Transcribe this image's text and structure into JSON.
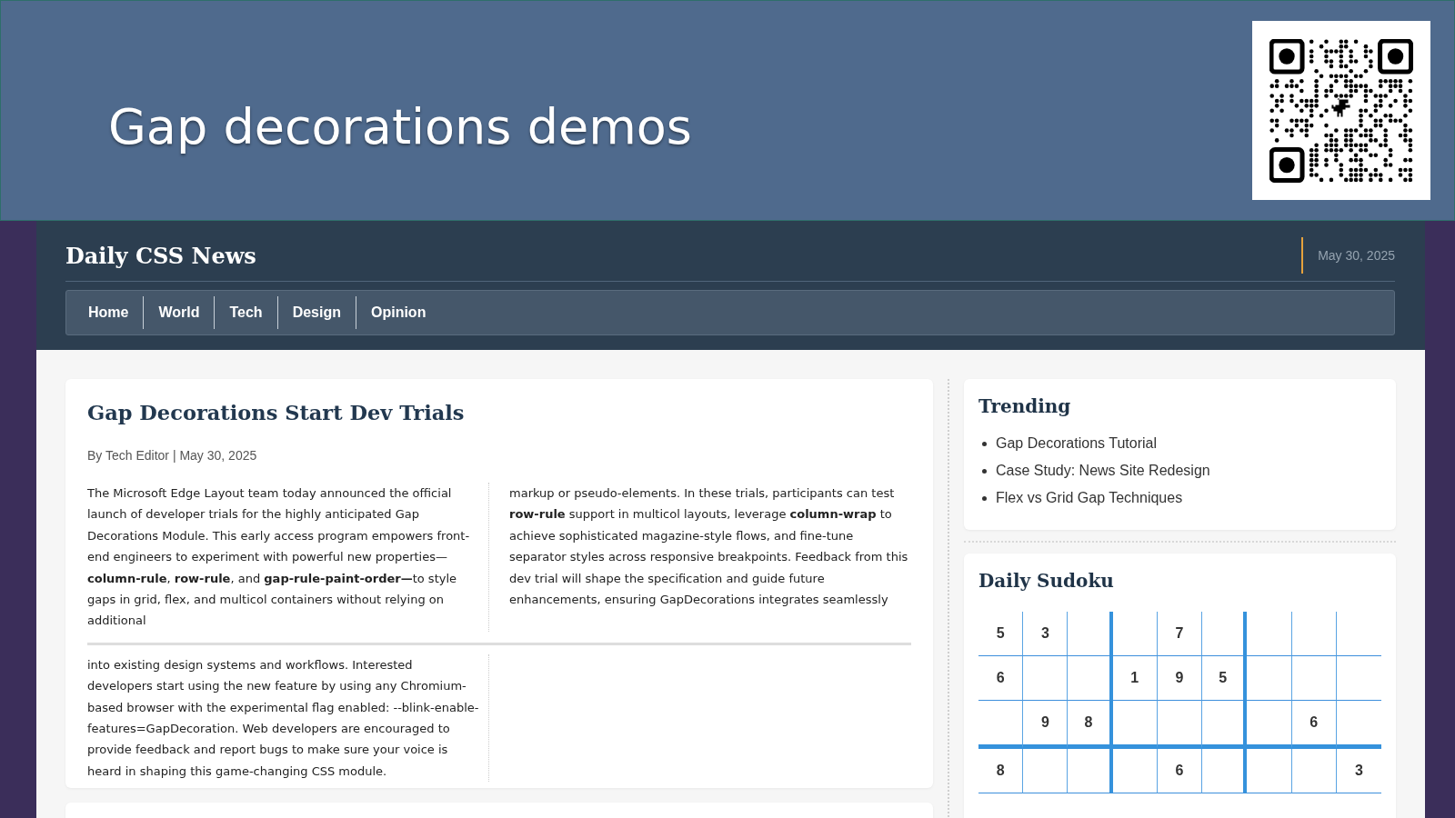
{
  "slide": {
    "title": "Gap decorations demos"
  },
  "site": {
    "title": "Daily CSS News",
    "date": "May 30, 2025",
    "nav": [
      {
        "label": "Home"
      },
      {
        "label": "World"
      },
      {
        "label": "Tech"
      },
      {
        "label": "Design"
      },
      {
        "label": "Opinion"
      }
    ]
  },
  "article": {
    "headline": "Gap Decorations Start Dev Trials",
    "byline": "By Tech Editor | May 30, 2025",
    "columns": [
      "The Microsoft Edge Layout team today announced the official launch of developer trials for the highly anticipated Gap Decorations Module. This early access program empowers front-end engineers to experiment with powerful new properties—**column-rule**, **row-rule**, and **gap-rule-paint-order—**to style gaps in grid, flex, and multicol containers without relying on additional",
      "markup or pseudo-elements. In these trials, participants can test **row-rule** support in multicol layouts, leverage **column-wrap** to achieve sophisticated magazine-style flows, and fine-tune separator styles across responsive breakpoints. Feedback from this dev trial will shape the specification and guide future enhancements, ensuring GapDecorations integrates seamlessly",
      "into existing design systems and workflows. Interested developers start using the new feature by using any Chromium-based browser with the experimental flag enabled: --blink-enable-features=GapDecoration. Web developers are encouraged to provide feedback and report bugs to make sure your voice is heard in shaping this game-changing CSS module."
    ]
  },
  "trending": {
    "title": "Trending",
    "items": [
      "Gap Decorations Tutorial",
      "Case Study: News Site Redesign",
      "Flex vs Grid Gap Techniques"
    ]
  },
  "sudoku": {
    "title": "Daily Sudoku",
    "rows": [
      [
        "5",
        "3",
        null,
        null,
        "7",
        null,
        null,
        null,
        null
      ],
      [
        "6",
        null,
        null,
        "1",
        "9",
        "5",
        null,
        null,
        null
      ],
      [
        null,
        "9",
        "8",
        null,
        null,
        null,
        null,
        "6",
        null
      ],
      [
        "8",
        null,
        null,
        null,
        "6",
        null,
        null,
        null,
        "3"
      ]
    ]
  }
}
